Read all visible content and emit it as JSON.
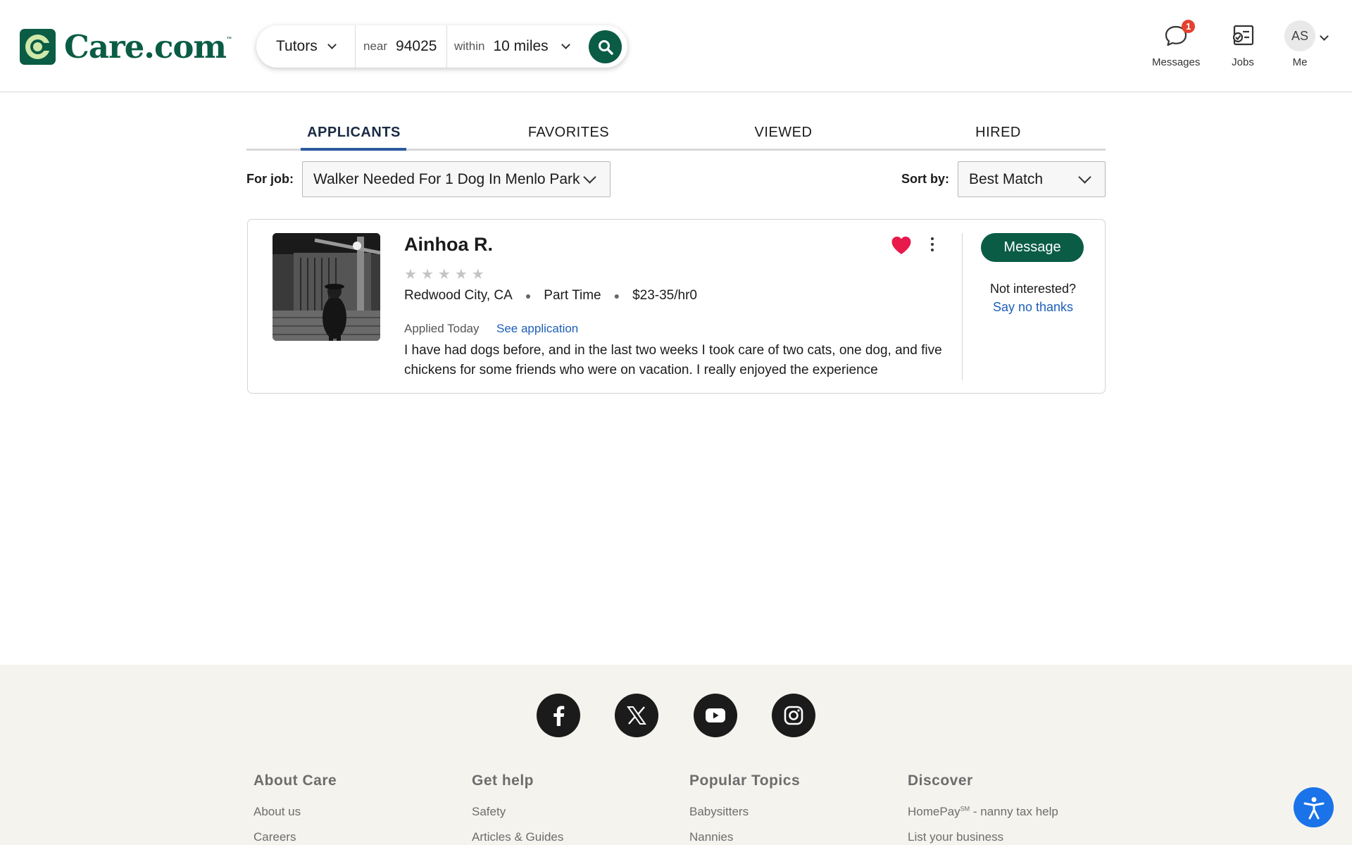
{
  "header": {
    "logo_text": "Care.com",
    "logo_tm": "™",
    "search": {
      "service": "Tutors",
      "near_label": "near",
      "zip": "94025",
      "within_label": "within",
      "distance": "10 miles"
    },
    "nav": {
      "messages_label": "Messages",
      "messages_badge": "1",
      "jobs_label": "Jobs",
      "me_label": "Me",
      "avatar_initials": "AS"
    }
  },
  "tabs": [
    {
      "label": "APPLICANTS",
      "active": true
    },
    {
      "label": "FAVORITES",
      "active": false
    },
    {
      "label": "VIEWED",
      "active": false
    },
    {
      "label": "HIRED",
      "active": false
    }
  ],
  "filters": {
    "for_job_label": "For job:",
    "for_job_value": "Walker Needed For 1 Dog In Menlo Park",
    "sort_label": "Sort by:",
    "sort_value": "Best Match"
  },
  "applicant": {
    "name": "Ainhoa R.",
    "rating": 0,
    "rating_max": 5,
    "location": "Redwood City, CA",
    "schedule": "Part Time",
    "rate": "$23-35/hr0",
    "applied": "Applied Today",
    "see_application": "See application",
    "description": "I have had dogs before, and in the last two weeks I took care of two cats, one dog, and five chickens for some friends who were on vacation. I really enjoyed the experience",
    "favorited": true,
    "message_button": "Message",
    "not_interested": "Not interested?",
    "say_no_thanks": "Say no thanks"
  },
  "footer": {
    "social": [
      "facebook-icon",
      "x-icon",
      "youtube-icon",
      "instagram-icon"
    ],
    "columns": [
      {
        "heading": "About Care",
        "links": [
          "About us",
          "Careers"
        ]
      },
      {
        "heading": "Get help",
        "links": [
          "Safety",
          "Articles & Guides"
        ]
      },
      {
        "heading": "Popular Topics",
        "links": [
          "Babysitters",
          "Nannies"
        ]
      },
      {
        "heading": "Discover",
        "links": [
          "HomePay",
          "List your business"
        ]
      }
    ],
    "homepay_sm": "SM",
    "homepay_suffix": " - nanny tax help"
  },
  "colors": {
    "brand_green": "#0a5c45",
    "link_blue": "#1d5fb8",
    "heart_red": "#e8194b",
    "badge_red": "#e4412f",
    "footer_bg": "#f5f3ee",
    "a11y_blue": "#1a73e8"
  }
}
